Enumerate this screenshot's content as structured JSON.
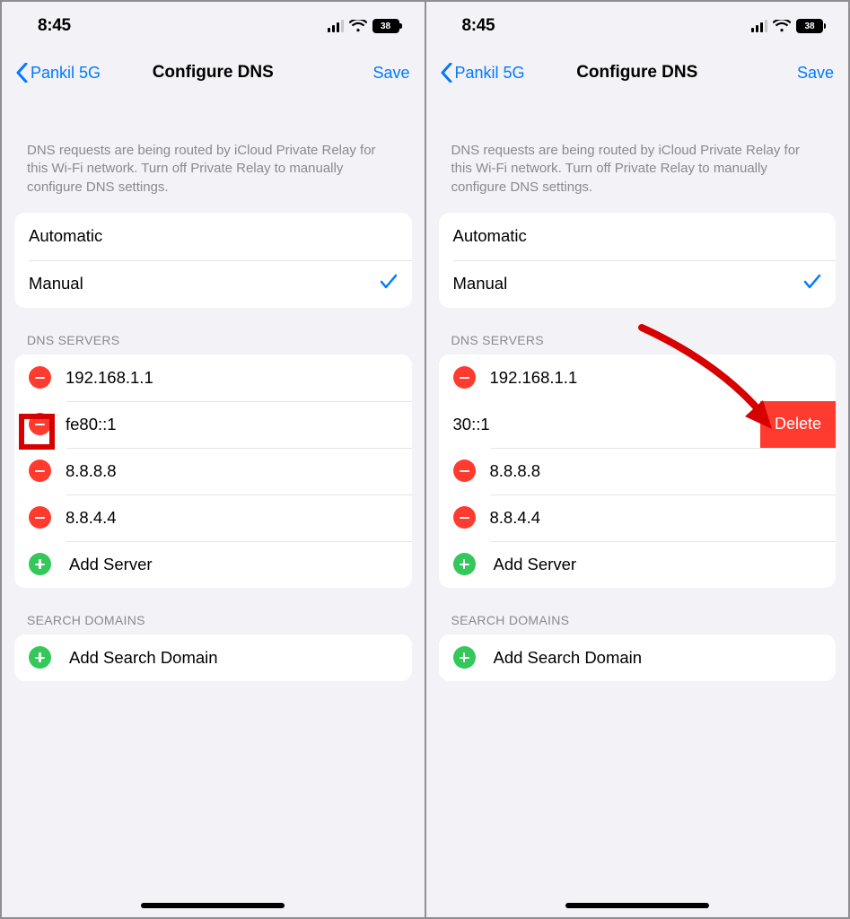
{
  "status": {
    "time": "8:45",
    "battery": "38"
  },
  "nav": {
    "back_label": "Pankil 5G",
    "title": "Configure DNS",
    "save": "Save"
  },
  "info_text": "DNS requests are being routed by iCloud Private Relay for this Wi-Fi network. Turn off Private Relay to manually configure DNS settings.",
  "mode": {
    "automatic": "Automatic",
    "manual": "Manual"
  },
  "sections": {
    "dns_servers": "DNS SERVERS",
    "search_domains": "SEARCH DOMAINS"
  },
  "dns_servers": {
    "s1": "192.168.1.1",
    "s2": "fe80::1",
    "s2_swiped_visible": "30::1",
    "s3": "8.8.8.8",
    "s4": "8.8.4.4"
  },
  "actions": {
    "add_server": "Add Server",
    "add_search_domain": "Add Search Domain",
    "delete": "Delete"
  }
}
